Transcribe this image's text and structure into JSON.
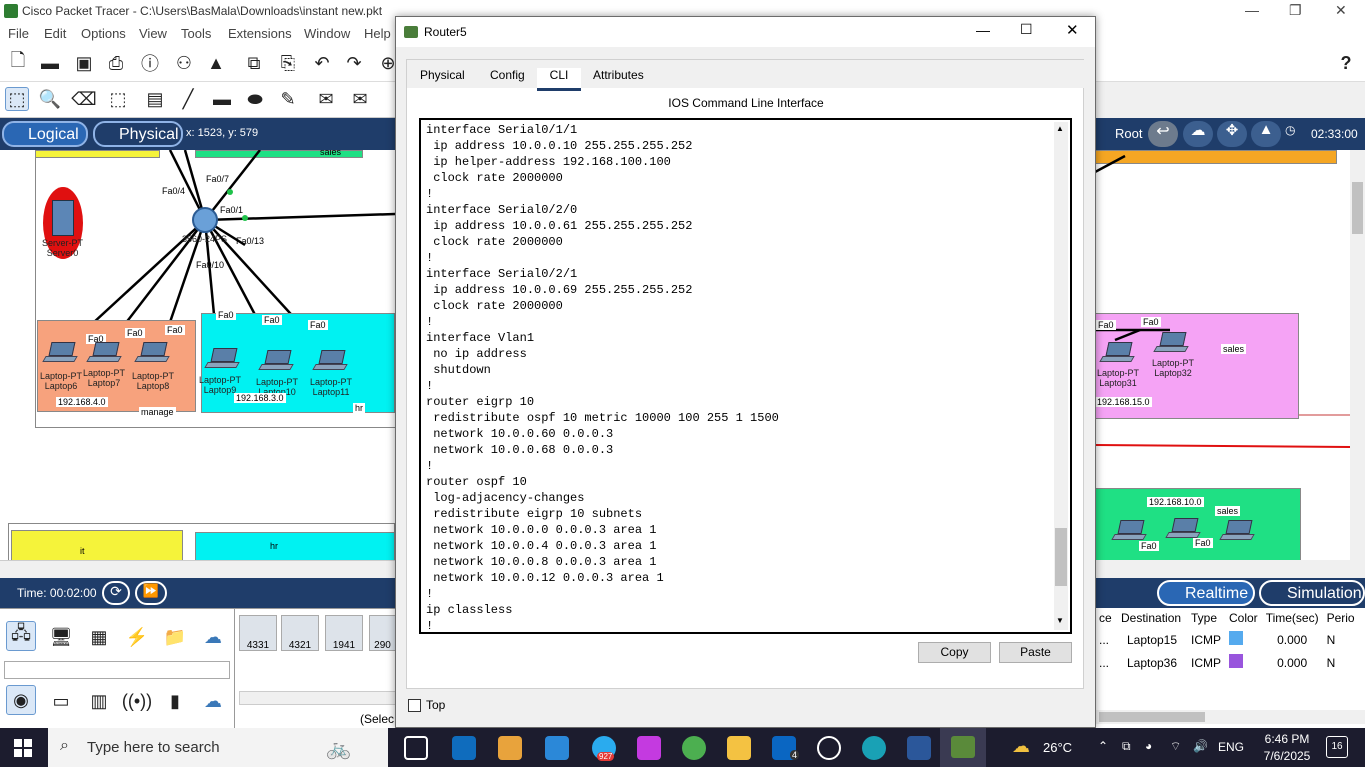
{
  "app": {
    "title": "Cisco Packet Tracer - C:\\Users\\BasMala\\Downloads\\instant new.pkt",
    "menu": [
      "File",
      "Edit",
      "Options",
      "View",
      "Tools",
      "Extensions",
      "Window",
      "Help"
    ],
    "help_glyph": "?"
  },
  "view": {
    "logical_label": "Logical",
    "physical_label": "Physical",
    "coords": "x: 1523, y: 579",
    "root_label": "Root",
    "clock": "02:33:00"
  },
  "workspace": {
    "server_caption": "Server-PT\nServer0",
    "switch_caption": "3560-24PS",
    "ports": [
      "Fa0/4",
      "Fa0/7",
      "Fa0/1",
      "Fa0/13",
      "Fa0/10",
      "Fa0",
      "Fa0",
      "Fa0",
      "Fa0",
      "Fa0",
      "Fa0"
    ],
    "laptops_manage": [
      "Laptop-PT\nLaptop6",
      "Laptop-PT\nLaptop7",
      "Laptop-PT\nLaptop8"
    ],
    "laptops_hr": [
      "Laptop-PT\nLaptop9",
      "Laptop-PT\nLaptop10",
      "Laptop-PT\nLaptop11"
    ],
    "net_manage": "192.168.4.0",
    "net_hr": "192.168.3.0",
    "label_manage": "manage",
    "label_hr": "hr",
    "label_sales_top": "sales",
    "label_it": "it",
    "label_hr2": "hr",
    "right_laptops": [
      "Laptop-PT\nLaptop31",
      "Laptop-PT\nLaptop32"
    ],
    "right_net": "192.168.15.0",
    "right_sales": "sales",
    "right_net2": "192.168.10.0",
    "right_sales2": "sales",
    "right_port": "Fa0"
  },
  "sim": {
    "time": "Time: 00:02:00",
    "realtime": "Realtime",
    "simulation": "Simulation",
    "device_models": [
      "4331",
      "4321",
      "1941",
      "290"
    ],
    "select_hint": "(Selec"
  },
  "events": {
    "columns": [
      "ce",
      "Destination",
      "Type",
      "Color",
      "Time(sec)",
      "Perio"
    ],
    "rows": [
      {
        "src": "...",
        "dest": "Laptop15",
        "type": "ICMP",
        "color": "#55aaee",
        "time": "0.000",
        "period": "N"
      },
      {
        "src": "...",
        "dest": "Laptop36",
        "type": "ICMP",
        "color": "#9955dd",
        "time": "0.000",
        "period": "N"
      }
    ]
  },
  "dialog": {
    "title": "Router5",
    "tabs": [
      "Physical",
      "Config",
      "CLI",
      "Attributes"
    ],
    "active_tab": "CLI",
    "cli_title": "IOS Command Line Interface",
    "cli_lines": [
      "interface Serial0/1/1",
      " ip address 10.0.0.10 255.255.255.252",
      " ip helper-address 192.168.100.100",
      " clock rate 2000000",
      "!",
      "interface Serial0/2/0",
      " ip address 10.0.0.61 255.255.255.252",
      " clock rate 2000000",
      "!",
      "interface Serial0/2/1",
      " ip address 10.0.0.69 255.255.255.252",
      " clock rate 2000000",
      "!",
      "interface Vlan1",
      " no ip address",
      " shutdown",
      "!",
      "router eigrp 10",
      " redistribute ospf 10 metric 10000 100 255 1 1500",
      " network 10.0.0.60 0.0.0.3",
      " network 10.0.0.68 0.0.0.3",
      "!",
      "router ospf 10",
      " log-adjacency-changes",
      " redistribute eigrp 10 subnets",
      " network 10.0.0.0 0.0.0.3 area 1",
      " network 10.0.0.4 0.0.0.3 area 1",
      " network 10.0.0.8 0.0.0.3 area 1",
      " network 10.0.0.12 0.0.0.3 area 1",
      "!",
      "ip classless",
      "!"
    ],
    "copy_label": "Copy",
    "paste_label": "Paste",
    "top_label": "Top"
  },
  "taskbar": {
    "search_placeholder": "Type here to search",
    "weather": "26°C",
    "lang": "ENG",
    "time": "6:46 PM",
    "date": "7/6/2025",
    "notif_count": "16",
    "badge_telegram": "927",
    "badge_linkedin": "4"
  }
}
